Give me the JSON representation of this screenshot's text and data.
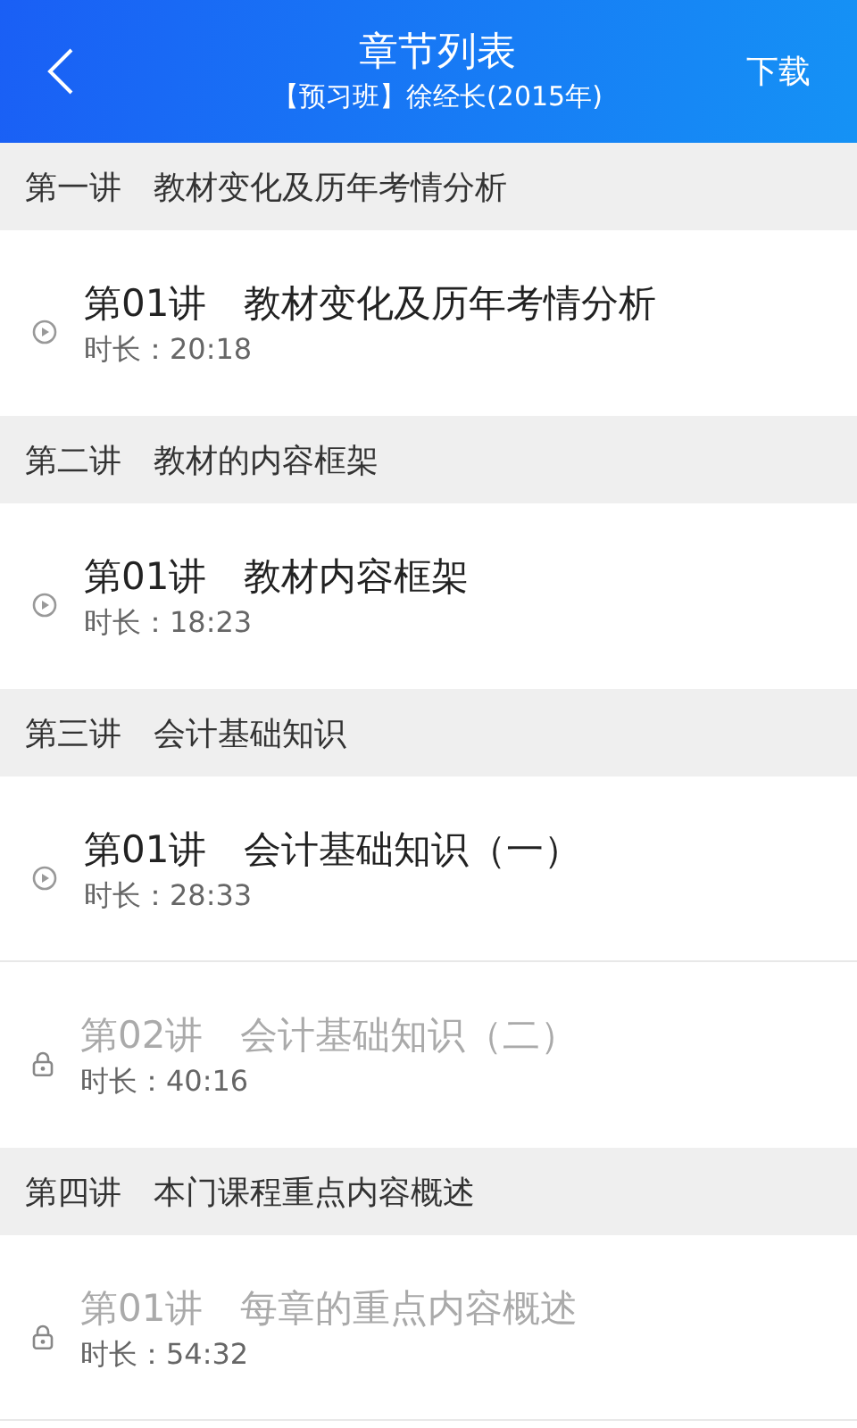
{
  "header": {
    "title": "章节列表",
    "subtitle": "【预习班】徐经长(2015年)",
    "action": "下载"
  },
  "chapters": [
    {
      "title": "第一讲　教材变化及历年考情分析",
      "lessons": [
        {
          "title": "第01讲　教材变化及历年考情分析",
          "duration": "时长：20:18",
          "locked": false
        }
      ]
    },
    {
      "title": "第二讲　教材的内容框架",
      "lessons": [
        {
          "title": "第01讲　教材内容框架",
          "duration": "时长：18:23",
          "locked": false
        }
      ]
    },
    {
      "title": "第三讲　会计基础知识",
      "lessons": [
        {
          "title": "第01讲　会计基础知识（一）",
          "duration": "时长：28:33",
          "locked": false
        },
        {
          "title": "第02讲　会计基础知识（二）",
          "duration": "时长：40:16",
          "locked": true
        }
      ]
    },
    {
      "title": "第四讲　本门课程重点内容概述",
      "lessons": [
        {
          "title": "第01讲　每章的重点内容概述",
          "duration": "时长：54:32",
          "locked": true
        }
      ]
    }
  ]
}
